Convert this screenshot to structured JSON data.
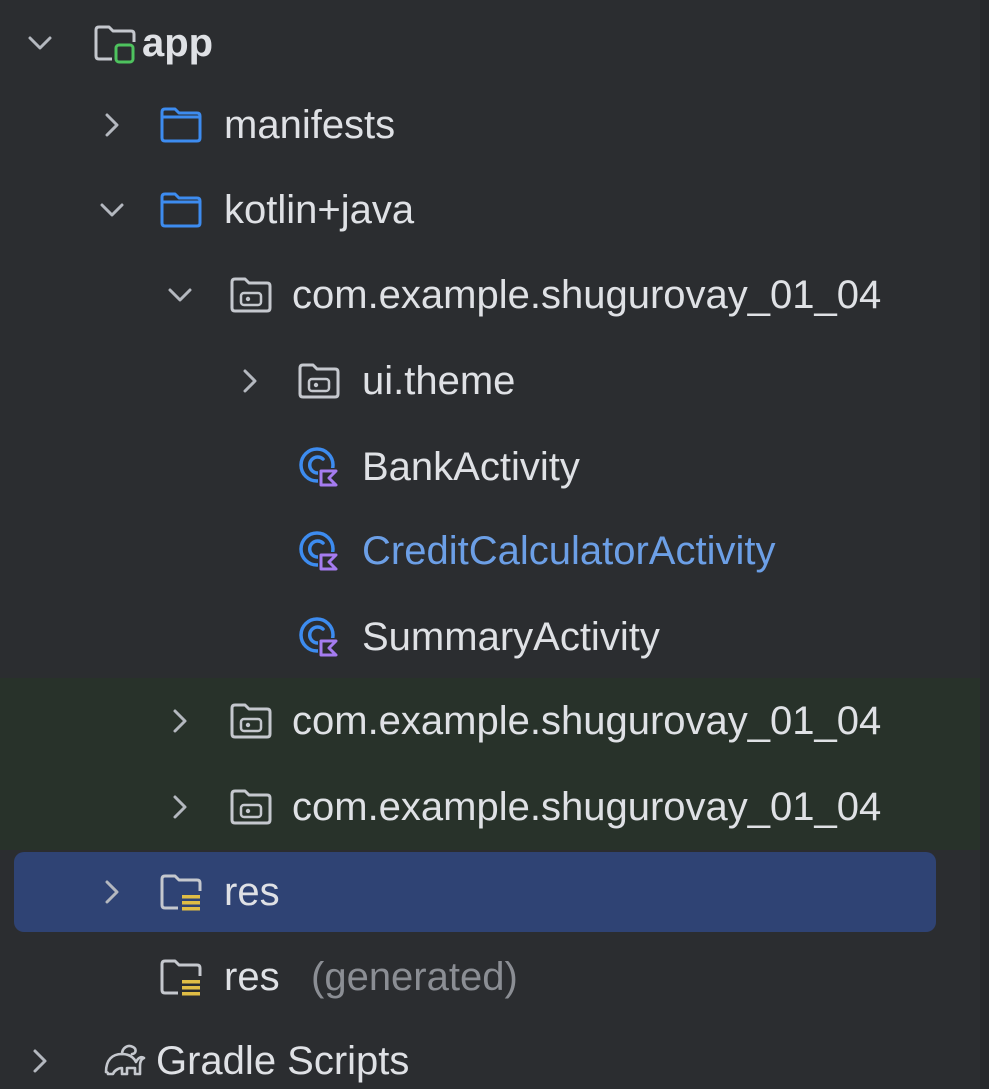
{
  "project_tree": {
    "items": [
      {
        "label": "app",
        "expanded": true
      },
      {
        "label": "manifests",
        "expanded": false
      },
      {
        "label": "kotlin+java",
        "expanded": true
      },
      {
        "label": "com.example.shugurovay_01_04",
        "expanded": true
      },
      {
        "label": "ui.theme",
        "expanded": false
      },
      {
        "label": "BankActivity"
      },
      {
        "label": "CreditCalculatorActivity",
        "state": "modified"
      },
      {
        "label": "SummaryActivity"
      },
      {
        "label": "com.example.shugurovay_01_04",
        "expanded": false
      },
      {
        "label": "com.example.shugurovay_01_04",
        "expanded": false
      },
      {
        "label": "res",
        "expanded": false,
        "selected": true
      },
      {
        "label": "res",
        "suffix": "(generated)"
      },
      {
        "label": "Gradle Scripts",
        "expanded": false
      }
    ]
  },
  "colors": {
    "background": "#2b2d30",
    "selection": "#2f4374",
    "test_highlight": "#28322a",
    "text": "#dfe1e5",
    "modified_text": "#6c9fe6",
    "muted_text": "#8b8e94",
    "folder_blue": "#3d8cf0",
    "kotlin_purple": "#a57cf0",
    "module_green": "#4ec35e",
    "resource_yellow": "#e0bd45"
  }
}
